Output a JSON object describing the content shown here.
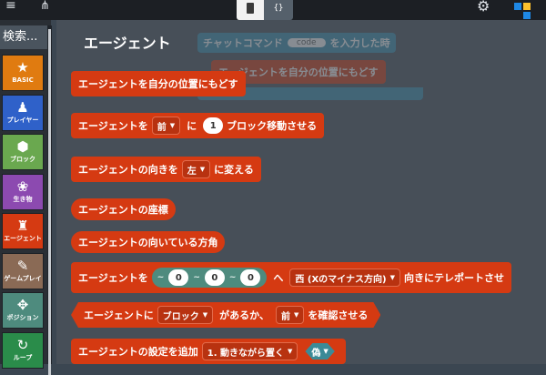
{
  "toolbar": {
    "blocks_mode_label": "",
    "js_mode_label": "{}"
  },
  "search": {
    "label": "検索..."
  },
  "categories": [
    {
      "name": "BASIC",
      "glyph": "★",
      "color": "#e07b10"
    },
    {
      "name": "プレイヤー",
      "glyph": "♟",
      "color": "#2f61c9"
    },
    {
      "name": "ブロック",
      "glyph": "⬢",
      "color": "#6aa84f"
    },
    {
      "name": "生き物",
      "glyph": "❀",
      "color": "#8c4ab0"
    },
    {
      "name": "エージェント",
      "glyph": "♜",
      "color": "#d53a12"
    },
    {
      "name": "ゲームプレイ",
      "glyph": "✎",
      "color": "#8a6a55"
    },
    {
      "name": "ポジション",
      "glyph": "✥",
      "color": "#4e8b7e"
    },
    {
      "name": "ループ",
      "glyph": "↻",
      "color": "#2a8c4a"
    }
  ],
  "flyout": {
    "title": "エージェント",
    "ghost": {
      "chat_label": "チャットコマンド",
      "chat_param": "code",
      "chat_suffix": "を入力した時",
      "inner": "エージェントを自分の位置にもどす"
    },
    "blocks": [
      {
        "text": "エージェントを自分の位置にもどす"
      },
      {
        "prefix": "エージェントを",
        "dir": "前",
        "mid": "に",
        "value": "1",
        "suffix": "ブロック移動させる"
      },
      {
        "prefix": "エージェントの向きを",
        "dir": "左",
        "suffix": "に変える"
      },
      {
        "text": "エージェントの座標"
      },
      {
        "text": "エージェントの向いている方角"
      },
      {
        "prefix": "エージェントを",
        "tilde": "~",
        "x": "0",
        "y": "0",
        "z": "0",
        "mid": "へ",
        "dir": "西 (Xのマイナス方向)",
        "suffix": "向きにテレポートさせ"
      },
      {
        "prefix": "エージェントに",
        "dir": "ブロック",
        "mid": "があるか、",
        "dir2": "前",
        "suffix": "を確認させる"
      },
      {
        "prefix": "エージェントの設定を追加",
        "dir": "1. 動きながら置く",
        "bool": "偽"
      }
    ]
  },
  "colors": {
    "agent": "#d53a12",
    "position": "#4e8b7e",
    "logic": "#3b8a97"
  }
}
